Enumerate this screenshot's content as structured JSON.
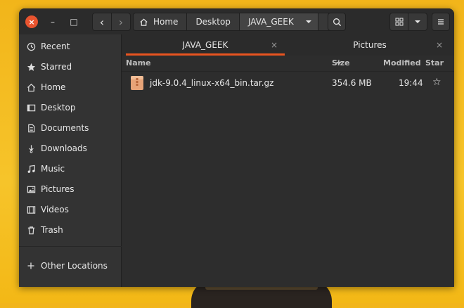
{
  "window": {
    "close_glyph": "×",
    "minimize_glyph": "–",
    "maximize_glyph": "□"
  },
  "nav": {
    "back_glyph": "‹",
    "forward_glyph": "›"
  },
  "breadcrumbs": [
    {
      "label": "Home"
    },
    {
      "label": "Desktop"
    },
    {
      "label": "JAVA_GEEK"
    }
  ],
  "sidebar": {
    "items": [
      {
        "label": "Recent",
        "icon": "clock-icon"
      },
      {
        "label": "Starred",
        "icon": "star-icon"
      },
      {
        "label": "Home",
        "icon": "home-icon"
      },
      {
        "label": "Desktop",
        "icon": "desktop-icon"
      },
      {
        "label": "Documents",
        "icon": "document-icon"
      },
      {
        "label": "Downloads",
        "icon": "download-icon"
      },
      {
        "label": "Music",
        "icon": "music-icon"
      },
      {
        "label": "Pictures",
        "icon": "picture-icon"
      },
      {
        "label": "Videos",
        "icon": "video-icon"
      },
      {
        "label": "Trash",
        "icon": "trash-icon"
      }
    ],
    "other_locations": {
      "label": "Other Locations",
      "icon": "plus-icon"
    }
  },
  "tabs": [
    {
      "label": "JAVA_GEEK",
      "active": true
    },
    {
      "label": "Pictures",
      "active": false
    }
  ],
  "tab_close_glyph": "×",
  "columns": {
    "name": "Name",
    "size": "Size",
    "modified": "Modified",
    "star": "Star"
  },
  "files": [
    {
      "name": "jdk-9.0.4_linux-x64_bin.tar.gz",
      "size": "354.6 MB",
      "modified": "19:44",
      "star_glyph": "☆",
      "icon": "archive-file-icon"
    }
  ],
  "colors": {
    "accent": "#e95420",
    "close_button": "#e9542f",
    "archive_icon": "#e8a478"
  }
}
